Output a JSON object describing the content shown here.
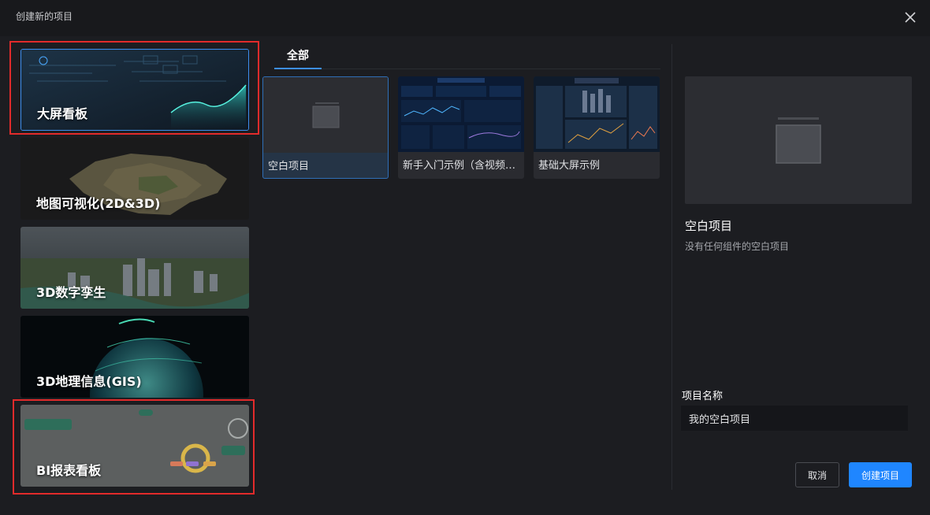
{
  "dialog": {
    "title": "创建新的项目",
    "close_icon": "close-icon"
  },
  "categories": [
    {
      "label": "大屏看板",
      "selected": true
    },
    {
      "label": "地图可视化(2D&3D)",
      "selected": false
    },
    {
      "label": "3D数字孪生",
      "selected": false
    },
    {
      "label": "3D地理信息(GIS)",
      "selected": false
    },
    {
      "label": "BI报表看板",
      "selected": false
    }
  ],
  "tabs": [
    {
      "label": "全部",
      "active": true
    }
  ],
  "templates": [
    {
      "name": "空白项目",
      "active": true,
      "thumb_icon": "blank-page-icon"
    },
    {
      "name": "新手入门示例（含视频…",
      "active": false
    },
    {
      "name": "基础大屏示例",
      "active": false
    }
  ],
  "preview": {
    "title": "空白项目",
    "description": "没有任何组件的空白项目",
    "thumb_icon": "blank-page-icon"
  },
  "form": {
    "name_label": "项目名称",
    "name_value": "我的空白项目"
  },
  "buttons": {
    "cancel": "取消",
    "create": "创建项目"
  },
  "colors": {
    "accent": "#1f86ff",
    "highlight_frame": "#e22b2b",
    "background": "#1c1d21"
  }
}
